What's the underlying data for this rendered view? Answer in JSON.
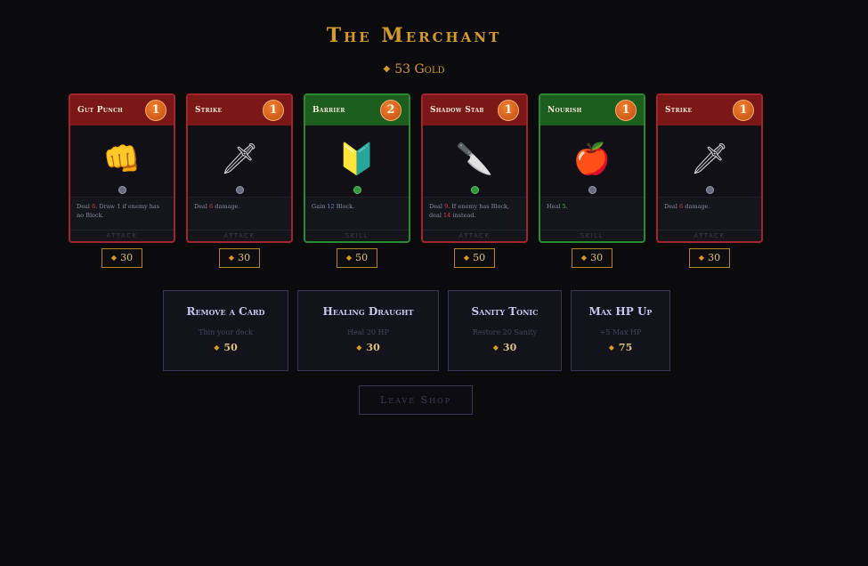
{
  "header": {
    "title": "The Merchant",
    "gold_icon": "gold-diamond-icon",
    "gold": "53 Gold"
  },
  "cards": [
    {
      "name": "Gut Punch",
      "cost": "1",
      "type": "attack",
      "type_label": "ATTACK",
      "art": "fist-icon",
      "art_glyph": "👊",
      "desc_parts": [
        [
          "Deal ",
          ""
        ],
        [
          "6",
          "red"
        ],
        [
          ". Draw 1 if enemy has no Block.",
          ""
        ]
      ],
      "price": "30",
      "dot": "grey"
    },
    {
      "name": "Strike",
      "cost": "1",
      "type": "attack",
      "type_label": "ATTACK",
      "art": "dagger-icon",
      "art_glyph": "🗡",
      "desc_parts": [
        [
          "Deal ",
          ""
        ],
        [
          "6",
          "red"
        ],
        [
          " damage.",
          ""
        ]
      ],
      "price": "30",
      "dot": "grey"
    },
    {
      "name": "Barrier",
      "cost": "2",
      "type": "skill",
      "type_label": "SKILL",
      "art": "shield-icon",
      "art_glyph": "🔰",
      "desc_parts": [
        [
          "Gain ",
          ""
        ],
        [
          "12",
          "blue"
        ],
        [
          " Block.",
          ""
        ]
      ],
      "price": "50",
      "dot": "green"
    },
    {
      "name": "Shadow Stab",
      "cost": "1",
      "type": "attack",
      "type_label": "ATTACK",
      "art": "knife-icon",
      "art_glyph": "🔪",
      "desc_parts": [
        [
          "Deal ",
          ""
        ],
        [
          "9",
          "red"
        ],
        [
          ". If enemy has Block, deal ",
          ""
        ],
        [
          "14",
          "red"
        ],
        [
          " instead.",
          ""
        ]
      ],
      "price": "50",
      "dot": "green"
    },
    {
      "name": "Nourish",
      "cost": "1",
      "type": "skill",
      "type_label": "SKILL",
      "art": "apple-icon",
      "art_glyph": "🍎",
      "desc_parts": [
        [
          "Heal ",
          ""
        ],
        [
          "5",
          "grn"
        ],
        [
          ".",
          ""
        ]
      ],
      "price": "30",
      "dot": "grey"
    },
    {
      "name": "Strike",
      "cost": "1",
      "type": "attack",
      "type_label": "ATTACK",
      "art": "dagger-icon",
      "art_glyph": "🗡",
      "desc_parts": [
        [
          "Deal ",
          ""
        ],
        [
          "6",
          "red"
        ],
        [
          " damage.",
          ""
        ]
      ],
      "price": "30",
      "dot": "grey"
    }
  ],
  "services": [
    {
      "name": "Remove a Card",
      "desc": "Thin your deck",
      "price": "50"
    },
    {
      "name": "Healing Draught",
      "desc": "Heal 20 HP",
      "price": "30"
    },
    {
      "name": "Sanity Tonic",
      "desc": "Restore 20 Sanity",
      "price": "30"
    },
    {
      "name": "Max HP Up",
      "desc": "+5 Max HP",
      "price": "75"
    }
  ],
  "leave_label": "Leave Shop",
  "colors": {
    "gold": "#d39a2a",
    "attack": "#a3242a",
    "skill": "#2a8a2e"
  }
}
